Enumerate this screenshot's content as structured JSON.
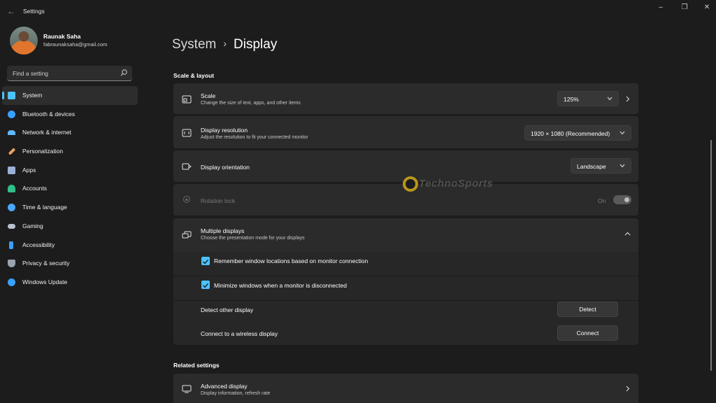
{
  "window": {
    "title": "Settings"
  },
  "user": {
    "name": "Raunak Saha",
    "email": "fabraunaksaha@gmail.com"
  },
  "search": {
    "placeholder": "Find a setting"
  },
  "sidebar": {
    "items": [
      {
        "label": "System",
        "icon": "monitor-icon",
        "color": "#4cc2ff"
      },
      {
        "label": "Bluetooth & devices",
        "icon": "bluetooth-icon",
        "color": "#3aa0ff"
      },
      {
        "label": "Network & internet",
        "icon": "wifi-icon",
        "color": "#5fb8ff"
      },
      {
        "label": "Personalization",
        "icon": "brush-icon",
        "color": "#e8a35c"
      },
      {
        "label": "Apps",
        "icon": "apps-icon",
        "color": "#9cb0d6"
      },
      {
        "label": "Accounts",
        "icon": "person-icon",
        "color": "#2fbf8a"
      },
      {
        "label": "Time & language",
        "icon": "globe-clock-icon",
        "color": "#4aa8ff"
      },
      {
        "label": "Gaming",
        "icon": "gamepad-icon",
        "color": "#b9c3cf"
      },
      {
        "label": "Accessibility",
        "icon": "accessibility-icon",
        "color": "#3aa0ff"
      },
      {
        "label": "Privacy & security",
        "icon": "shield-icon",
        "color": "#9aa4ae"
      },
      {
        "label": "Windows Update",
        "icon": "update-icon",
        "color": "#3aa0ff"
      }
    ]
  },
  "breadcrumb": {
    "parent": "System",
    "current": "Display"
  },
  "scale_layout": {
    "heading": "Scale & layout",
    "scale": {
      "title": "Scale",
      "desc": "Change the size of text, apps, and other items",
      "value": "125%"
    },
    "resolution": {
      "title": "Display resolution",
      "desc": "Adjust the resolution to fit your connected monitor",
      "value": "1920 × 1080 (Recommended)"
    },
    "orientation": {
      "title": "Display orientation",
      "value": "Landscape"
    },
    "rotation": {
      "title": "Rotation lock",
      "state": "On"
    },
    "multiple": {
      "title": "Multiple displays",
      "desc": "Choose the presentation mode for your displays",
      "remember": "Remember window locations based on monitor connection",
      "minimize": "Minimize windows when a monitor is disconnected",
      "detect_label": "Detect other display",
      "detect_button": "Detect",
      "connect_label": "Connect to a wireless display",
      "connect_button": "Connect"
    }
  },
  "related": {
    "heading": "Related settings",
    "advanced": {
      "title": "Advanced display",
      "desc": "Display information, refresh rate"
    }
  },
  "watermark": {
    "text": "TechnoSports"
  },
  "colors": {
    "accent": "#4cc2ff",
    "background": "#1c1c1c",
    "card": "#2b2b2b"
  }
}
